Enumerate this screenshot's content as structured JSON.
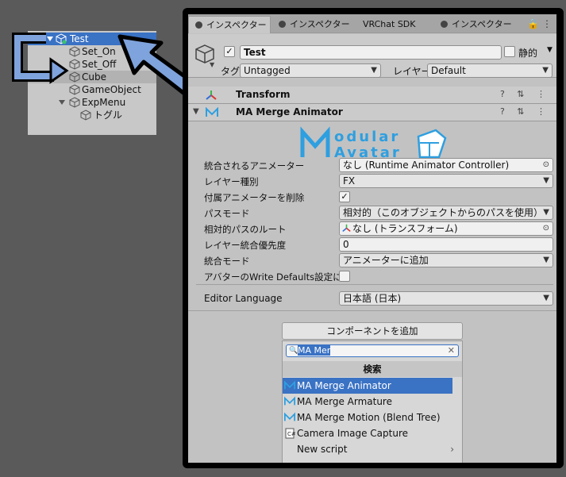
{
  "hierarchy": {
    "items": [
      {
        "label": "Test",
        "depth": 0,
        "expanded": true,
        "selected": true
      },
      {
        "label": "Set_On",
        "depth": 1
      },
      {
        "label": "Set_Off",
        "depth": 1
      },
      {
        "label": "Cube",
        "depth": 1,
        "highlighted": true
      },
      {
        "label": "GameObject",
        "depth": 1
      },
      {
        "label": "ExpMenu",
        "depth": 1,
        "expanded": true
      },
      {
        "label": "トグル",
        "depth": 2
      }
    ]
  },
  "tabs": [
    {
      "label": "インスペクター",
      "active": true
    },
    {
      "label": "インスペクター",
      "active": false
    },
    {
      "label": "VRChat SDK",
      "active": false
    },
    {
      "label": "インスペクター",
      "active": false
    }
  ],
  "header": {
    "name": "Test",
    "static_label": "静的",
    "tag_label": "タグ",
    "tag_value": "Untagged",
    "layer_label": "レイヤー",
    "layer_value": "Default"
  },
  "components": {
    "transform": "Transform",
    "merge_animator": "MA Merge Animator"
  },
  "logo": {
    "line1": "Modular",
    "line2": "Avatar"
  },
  "fields": [
    {
      "label": "統合されるアニメーター",
      "value": "なし (Runtime Animator Controller)",
      "kind": "object"
    },
    {
      "label": "レイヤー種別",
      "value": "FX",
      "kind": "dropdown"
    },
    {
      "label": "付属アニメーターを削除",
      "value": "✓",
      "kind": "checkbox"
    },
    {
      "label": "パスモード",
      "value": "相対的（このオブジェクトからのパスを使用）",
      "kind": "dropdown"
    },
    {
      "label": "相対的パスのルート",
      "value": "なし (トランスフォーム)",
      "kind": "object"
    },
    {
      "label": "レイヤー統合優先度",
      "value": "0",
      "kind": "text"
    },
    {
      "label": "統合モード",
      "value": "アニメーターに追加",
      "kind": "dropdown"
    },
    {
      "label": "アバターのWrite Defaults設定に合",
      "value": "",
      "kind": "checkbox"
    }
  ],
  "editor_language": {
    "label": "Editor Language",
    "value": "日本語 (日本)"
  },
  "add_component": {
    "button_label": "コンポーネントを追加",
    "search_value": "MA Mer",
    "header": "検索",
    "results": [
      {
        "label": "MA Merge Animator",
        "icon": "ma-icon",
        "selected": true
      },
      {
        "label": "MA Merge Armature",
        "icon": "ma-icon"
      },
      {
        "label": "MA Merge Motion (Blend Tree)",
        "icon": "ma-icon"
      },
      {
        "label": "Camera Image Capture",
        "icon": "script-icon"
      },
      {
        "label": "New script",
        "icon": "",
        "submenu": true
      }
    ]
  },
  "colors": {
    "selection": "#3a72c4",
    "arrow": "#7fa3dd",
    "logo": "#2e9fe0"
  }
}
